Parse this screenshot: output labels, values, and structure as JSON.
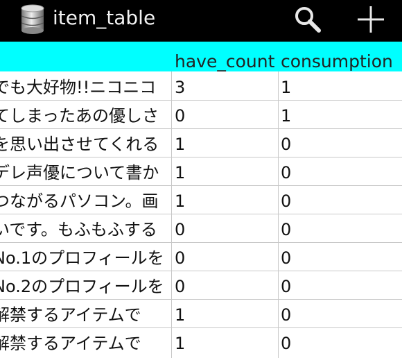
{
  "actionbar": {
    "title": "item_table",
    "icons": [
      "database-icon",
      "search-icon",
      "add-icon"
    ]
  },
  "table": {
    "columns": [
      "",
      "have_count",
      "consumption"
    ],
    "rows": [
      {
        "description": "でも大好物!!ニコニコ",
        "have_count": "3",
        "consumption": "1"
      },
      {
        "description": "てしまったあの優しさ",
        "have_count": "0",
        "consumption": "1"
      },
      {
        "description": "を思い出させてくれる",
        "have_count": "1",
        "consumption": "0"
      },
      {
        "description": "デレ声優について書か",
        "have_count": "1",
        "consumption": "0"
      },
      {
        "description": "つながるパソコン。画",
        "have_count": "1",
        "consumption": "0"
      },
      {
        "description": "いです。もふもふする",
        "have_count": "0",
        "consumption": "0"
      },
      {
        "description": "No.1のプロフィールを",
        "have_count": "0",
        "consumption": "0"
      },
      {
        "description": "No.2のプロフィールを",
        "have_count": "0",
        "consumption": "0"
      },
      {
        "description": "解禁するアイテムで",
        "have_count": "1",
        "consumption": "0"
      },
      {
        "description": "解禁するアイテムで",
        "have_count": "1",
        "consumption": "0"
      }
    ]
  },
  "colors": {
    "actionbar_bg": "#000000",
    "header_bg": "#00ffff",
    "grid": "#c8c8c8"
  }
}
